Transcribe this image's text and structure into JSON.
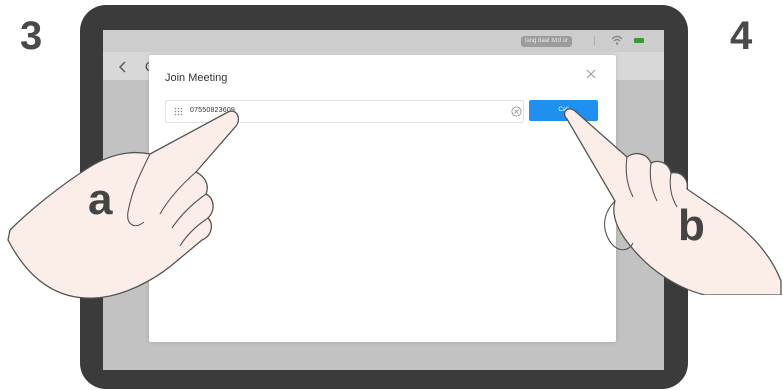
{
  "steps": {
    "left": "3",
    "right": "4"
  },
  "status_bar": {
    "chip_text": "lang daat tvtd ur"
  },
  "background_page": {
    "title": "C"
  },
  "dialog": {
    "title": "Join Meeting",
    "input_value": "07550823609",
    "call_label": "Call"
  },
  "hands": {
    "left_letter": "a",
    "right_letter": "b"
  },
  "colors": {
    "tablet_frame": "#3b3b3b",
    "screen_bg": "#c2c2c2",
    "call_button": "#1f8ff0",
    "battery": "#3a9a3a",
    "hand_fill": "#fbeee9",
    "hand_stroke": "#555555"
  }
}
